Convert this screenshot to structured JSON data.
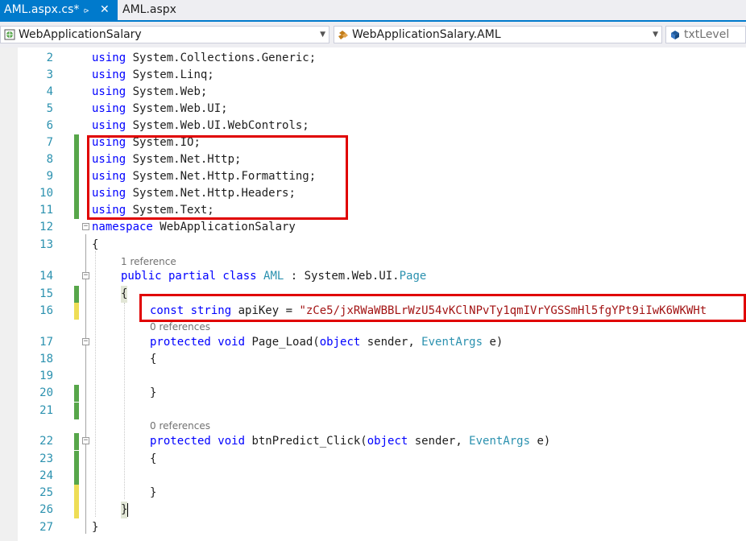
{
  "tabs": [
    {
      "label": "AML.aspx.cs*",
      "active": true,
      "pin_icon": "pin-icon",
      "close_icon": "close-icon"
    },
    {
      "label": "AML.aspx",
      "active": false
    }
  ],
  "navbar": {
    "project": "WebApplicationSalary",
    "type": "WebApplicationSalary.AML",
    "member": "txtLevel"
  },
  "editor": {
    "line_numbers": [
      "2",
      "3",
      "4",
      "5",
      "6",
      "7",
      "8",
      "9",
      "10",
      "11",
      "12",
      "13",
      "14",
      "15",
      "16",
      "17",
      "18",
      "19",
      "20",
      "21",
      "22",
      "23",
      "24",
      "25",
      "26",
      "27"
    ],
    "using_lines": [
      [
        "using",
        " System.Collections.Generic;"
      ],
      [
        "using",
        " System.Linq;"
      ],
      [
        "using",
        " System.Web;"
      ],
      [
        "using",
        " System.Web.UI;"
      ],
      [
        "using",
        " System.Web.UI.WebControls;"
      ],
      [
        "using",
        " System.IO;"
      ],
      [
        "using",
        " System.Net.Http;"
      ],
      [
        "using",
        " System.Net.Http.Formatting;"
      ],
      [
        "using",
        " System.Net.Http.Headers;"
      ],
      [
        "using",
        " System.Text;"
      ]
    ],
    "namespace_kw": "namespace",
    "namespace_name": " WebApplicationSalary",
    "open_brace": "{",
    "close_brace": "}",
    "ref_1": "1 reference",
    "ref_0a": "0 references",
    "ref_0b": "0 references",
    "class_kw": "public partial class ",
    "class_name": "AML",
    "class_sep": " : System.Web.UI.",
    "class_base": "Page",
    "const_kw": "const string",
    "const_name": " apiKey = ",
    "const_value": "\"zCe5/jxRWaWBBLrWzU54vKClNPvTy1qmIVrYGSSmHl5fgYPt9iIwK6WKWHt",
    "m1_kw": "protected void",
    "m1_name": " Page_Load(",
    "m1_obj": "object",
    "m1_mid": " sender, ",
    "m1_args": "EventArgs",
    "m1_end": " e)",
    "m2_kw": "protected void",
    "m2_name": " btnPredict_Click(",
    "m2_obj": "object",
    "m2_mid": " sender, ",
    "m2_args": "EventArgs",
    "m2_end": " e)"
  },
  "colors": {
    "keyword": "#0000ff",
    "type": "#2b91af",
    "string": "#a31515",
    "highlight": "#e00000",
    "accent": "#007acc"
  }
}
